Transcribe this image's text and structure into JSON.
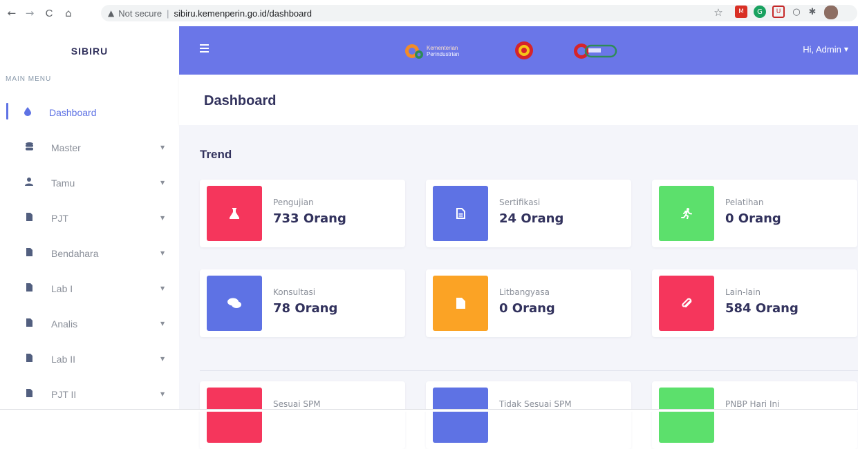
{
  "browser": {
    "back": "←",
    "forward": "→",
    "reload": "C",
    "home": "⌂",
    "security_warning": "▲",
    "security_text": "Not secure",
    "url": "sibiru.kemenperin.go.id/dashboard",
    "star": "☆"
  },
  "sidebar": {
    "brand": "SIBIRU",
    "heading": "MAIN MENU",
    "items": [
      {
        "label": "Dashboard",
        "icon": "●",
        "active": true
      },
      {
        "label": "Master",
        "icon": "≡"
      },
      {
        "label": "Tamu",
        "icon": "●"
      },
      {
        "label": "PJT",
        "icon": "■"
      },
      {
        "label": "Bendahara",
        "icon": "■"
      },
      {
        "label": "Lab I",
        "icon": "■"
      },
      {
        "label": "Analis",
        "icon": "■"
      },
      {
        "label": "Lab II",
        "icon": "■"
      },
      {
        "label": "PJT II",
        "icon": "■"
      }
    ],
    "caret": "▼"
  },
  "topbar": {
    "logo_line1": "Kementerian",
    "logo_line2": "Perindustrian",
    "user": "Hi, Admin",
    "caret": "▼"
  },
  "page": {
    "title": "Dashboard",
    "section": "Trend"
  },
  "cards": [
    {
      "label": "Pengujian",
      "value": "733 Orang",
      "color": "#f5365c",
      "icon": "⚗"
    },
    {
      "label": "Sertifikasi",
      "value": "24 Orang",
      "color": "#5e72e4",
      "icon": "🗎"
    },
    {
      "label": "Pelatihan",
      "value": "0 Orang",
      "color": "#2dce89",
      "icon": "🏃"
    },
    {
      "label": "Konsultasi",
      "value": "78 Orang",
      "color": "#5e72e4",
      "icon": "💬"
    },
    {
      "label": "Litbangyasa",
      "value": "0 Orang",
      "color": "#fb9f25",
      "icon": "■"
    },
    {
      "label": "Lain-lain",
      "value": "584 Orang",
      "color": "#f5365c",
      "icon": "📎"
    },
    {
      "label": "Sesuai SPM",
      "value": "",
      "color": "#f5365c",
      "icon": ""
    },
    {
      "label": "Tidak Sesuai SPM",
      "value": "",
      "color": "#5e72e4",
      "icon": ""
    },
    {
      "label": "PNBP Hari Ini",
      "value": "",
      "color": "#2dce89",
      "icon": ""
    }
  ]
}
